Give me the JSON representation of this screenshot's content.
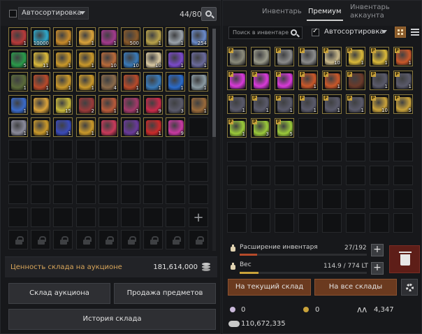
{
  "colors": {
    "accent_orange": "#b54a2a",
    "auction_label": "#d9a65a",
    "slot_border_item": "#8a7a3e",
    "premium_badge": "#c9a23c"
  },
  "left": {
    "autosort": {
      "checked": false,
      "label": "Автосортировка"
    },
    "slot_count": "44/80",
    "search_icon": "search-icon",
    "rows": [
      [
        {
          "icon": "potion-icon",
          "color": "#b83a3a",
          "qty": "1"
        },
        {
          "icon": "crystal-icon",
          "color": "#2fa7c9",
          "qty": "10000"
        },
        {
          "icon": "scroll-icon",
          "color": "#c78a2a",
          "qty": "1"
        },
        {
          "icon": "hammer-icon",
          "color": "#d9a23a",
          "qty": "1"
        },
        {
          "icon": "star-icon",
          "color": "#a23a8c",
          "qty": "1"
        },
        {
          "icon": "chest-icon",
          "color": "#8a5a2a",
          "qty": "500"
        },
        {
          "icon": "box-icon",
          "color": "#b8a24a",
          "qty": "1"
        },
        {
          "icon": "crate-icon",
          "color": "#9aa2aa",
          "qty": "1"
        },
        {
          "icon": "feather-icon",
          "color": "#6a8ac9",
          "qty": "254"
        }
      ],
      [
        {
          "icon": "leaf-icon",
          "color": "#2a9a4a",
          "qty": "5"
        },
        {
          "icon": "coupon-icon",
          "color": "#d9b83a",
          "qty": "11"
        },
        {
          "icon": "chest-gold-icon",
          "color": "#c9982a",
          "qty": "1"
        },
        {
          "icon": "chest-gold-icon",
          "color": "#c9982a",
          "qty": "1"
        },
        {
          "icon": "tea-icon",
          "color": "#b86a3a",
          "qty": "10"
        },
        {
          "icon": "box-blue-icon",
          "color": "#3a7ab8",
          "qty": "10"
        },
        {
          "icon": "letter-icon",
          "color": "#d9c9a2",
          "qty": "10"
        },
        {
          "icon": "feather-purple-icon",
          "color": "#7a4ac9",
          "qty": "1"
        },
        {
          "icon": "quill-icon",
          "color": "#6a6a9a",
          "qty": "1"
        },
        {
          "icon": "",
          "color": "#5a4a3a",
          "qty": ""
        }
      ],
      [
        {
          "icon": "bow-icon",
          "color": "#5a6a3a",
          "qty": "1"
        },
        {
          "icon": "chest-red-icon",
          "color": "#b84a2a",
          "qty": "1"
        },
        {
          "icon": "chest-gold-icon",
          "color": "#c9982a",
          "qty": "1"
        },
        {
          "icon": "chest-gold-icon",
          "color": "#c9982a",
          "qty": "1"
        },
        {
          "icon": "book-icon",
          "color": "#8a6a4a",
          "qty": "4"
        },
        {
          "icon": "chest-red-icon",
          "color": "#b84a2a",
          "qty": "1"
        },
        {
          "icon": "box-blue-icon",
          "color": "#3a7ab8",
          "qty": "1"
        },
        {
          "icon": "chest-blue-icon",
          "color": "#2a6ac9",
          "qty": "1"
        },
        {
          "icon": "tree-icon",
          "color": "#8a9aa2",
          "qty": "1"
        },
        {
          "icon": "glove-icon",
          "color": "#7a8a9a",
          "qty": "4"
        }
      ],
      [
        {
          "icon": "orb-icon",
          "color": "#3a6ac9",
          "qty": "1"
        },
        {
          "icon": "scroll-gold-icon",
          "color": "#d9a23a",
          "qty": ""
        },
        {
          "icon": "wing-icon",
          "color": "#c9b83a",
          "qty": "15"
        },
        {
          "icon": "stone-icon",
          "color": "#9a3a3a",
          "qty": "2"
        },
        {
          "icon": "ball-icon",
          "color": "#b85a3a",
          "qty": "1"
        },
        {
          "icon": "claw-icon",
          "color": "#a23a6a",
          "qty": "1"
        },
        {
          "icon": "gem-red-icon",
          "color": "#c92a4a",
          "qty": "9"
        },
        {
          "icon": "armor-icon",
          "color": "#5a5a6a",
          "qty": "3"
        },
        {
          "icon": "book-old-icon",
          "color": "#9a6a3a",
          "qty": "1"
        },
        {
          "icon": "",
          "color": "#1a1a1a",
          "qty": ""
        }
      ],
      [
        {
          "icon": "cube-icon",
          "color": "#8a8a9a",
          "qty": "1"
        },
        {
          "icon": "horse-icon",
          "color": "#c9982a",
          "qty": "1"
        },
        {
          "icon": "chest-blue-icon",
          "color": "#3a4ab8",
          "qty": "1"
        },
        {
          "icon": "chest-gold-icon",
          "color": "#c9982a",
          "qty": "1"
        },
        {
          "icon": "amulet-icon",
          "color": "#c93a5a",
          "qty": ""
        },
        {
          "icon": "chest-purple-icon",
          "color": "#6a3a9a",
          "qty": "4"
        },
        {
          "icon": "feather-red-icon",
          "color": "#c92a2a",
          "qty": "1"
        },
        {
          "icon": "swirl-icon",
          "color": "#c93aa2",
          "qty": "9"
        }
      ]
    ],
    "auction_value": {
      "label": "Ценность склада на аукционе",
      "value": "181,614,000"
    },
    "buttons": {
      "auction_storage": "Склад аукциона",
      "sell_items": "Продажа предметов",
      "storage_history": "История склада"
    }
  },
  "right": {
    "tabs": [
      "Инвентарь",
      "Премиум",
      "Инвентарь аккаунта"
    ],
    "active_tab": 1,
    "search": {
      "placeholder": "Поиск в инвентаре"
    },
    "autosort": {
      "checked": true,
      "label": "Автосортировка"
    },
    "rows": [
      [
        {
          "icon": "armor-chest-icon",
          "color": "#8a8a7a",
          "p": true,
          "qty": ""
        },
        {
          "icon": "gauntlet-icon",
          "color": "#9a9a8a",
          "p": false,
          "qty": ""
        },
        {
          "icon": "boots-icon",
          "color": "#8a8a8a",
          "p": true,
          "qty": ""
        },
        {
          "icon": "helmet-icon",
          "color": "#8a8a8a",
          "p": true,
          "qty": ""
        },
        {
          "icon": "map-icon",
          "color": "#c9b88a",
          "p": true,
          "qty": "10"
        },
        {
          "icon": "coupon-icon",
          "color": "#d9b83a",
          "p": true,
          "qty": "1"
        },
        {
          "icon": "coupon-icon",
          "color": "#d9b83a",
          "p": true,
          "qty": "1"
        },
        {
          "icon": "chest-red-icon",
          "color": "#c9582a",
          "p": true,
          "qty": "1"
        }
      ],
      [
        {
          "icon": "gift-pink-icon",
          "color": "#d93ad9",
          "p": true,
          "qty": ""
        },
        {
          "icon": "gift-pink-icon",
          "color": "#d93ad9",
          "p": true,
          "qty": ""
        },
        {
          "icon": "gift-pink-icon",
          "color": "#d93ad9",
          "p": true,
          "qty": ""
        },
        {
          "icon": "chest-red-icon",
          "color": "#c9582a",
          "p": true,
          "qty": "1"
        },
        {
          "icon": "chest-red-icon",
          "color": "#c9582a",
          "p": true,
          "qty": "1"
        },
        {
          "icon": "pot-icon",
          "color": "#6a3a2a",
          "p": true,
          "qty": ""
        },
        {
          "icon": "crate-icon",
          "color": "#5a5a6a",
          "p": true,
          "qty": "1"
        },
        {
          "icon": "crate-icon",
          "color": "#5a5a6a",
          "p": true,
          "qty": "1"
        }
      ],
      [
        {
          "icon": "crate-icon",
          "color": "#5a5a6a",
          "p": true,
          "qty": "1"
        },
        {
          "icon": "crate-icon",
          "color": "#5a5a6a",
          "p": true,
          "qty": "1"
        },
        {
          "icon": "crate-icon",
          "color": "#5a5a6a",
          "p": true,
          "qty": "1"
        },
        {
          "icon": "crate-icon",
          "color": "#5a5a6a",
          "p": true,
          "qty": "1"
        },
        {
          "icon": "crate-icon",
          "color": "#5a5a6a",
          "p": true,
          "qty": "1"
        },
        {
          "icon": "crate-icon",
          "color": "#5a5a6a",
          "p": true,
          "qty": "1"
        },
        {
          "icon": "elixir-gold-icon",
          "color": "#c9a23a",
          "p": true,
          "qty": "10"
        },
        {
          "icon": "elixir-gold-icon",
          "color": "#c9a23a",
          "p": true,
          "qty": "5"
        }
      ],
      [
        {
          "icon": "elixir-green-icon",
          "color": "#9ac93a",
          "p": true,
          "qty": "1"
        },
        {
          "icon": "elixir-green-icon",
          "color": "#9ac93a",
          "p": true,
          "qty": "3"
        },
        {
          "icon": "elixir-green-icon",
          "color": "#9ac93a",
          "p": true,
          "qty": "5"
        }
      ]
    ],
    "inventory_expansion": {
      "label": "Расширение инвентаря",
      "value": "27/192",
      "fill": 0.14
    },
    "weight": {
      "label": "Вес",
      "value": "114.9 / 774 LT",
      "fill": 0.15
    },
    "buttons": {
      "to_current": "На текущий склад",
      "to_all": "На все склады"
    },
    "currency": {
      "pearls": "0",
      "loyalty": "0",
      "crown_value": "4,347",
      "silver": "110,672,335"
    }
  }
}
